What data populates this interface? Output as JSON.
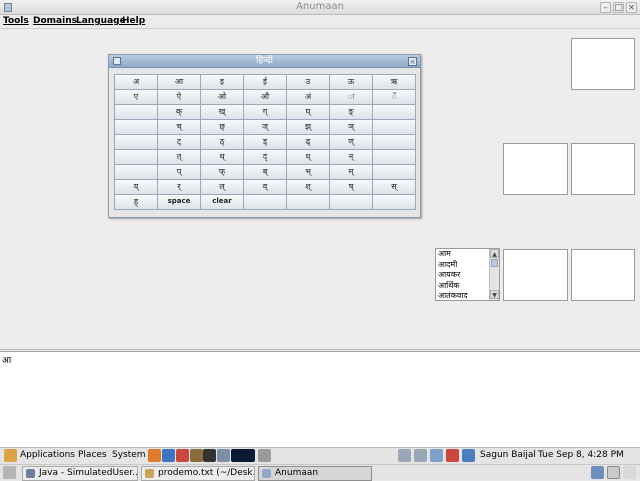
{
  "window": {
    "title": "Anumaan",
    "minimize": "–",
    "maximize": "□",
    "close": "×"
  },
  "menu": [
    "Tools",
    "Domains",
    "Language",
    "Help"
  ],
  "keyboard": {
    "title": "हिन्दी",
    "close": "×",
    "rows": [
      [
        "अ",
        "आ",
        "इ",
        "ई",
        "उ",
        "ऊ",
        "ऋ"
      ],
      [
        "ए",
        "ऐ",
        "ओ",
        "औ",
        "अं",
        "ः",
        "ॅ"
      ],
      [
        "",
        "क्",
        "ख्",
        "ग्",
        "घ्",
        "ङ्",
        ""
      ],
      [
        "",
        "च्",
        "छ्",
        "ज्",
        "झ्",
        "ञ्",
        ""
      ],
      [
        "",
        "ट्",
        "ठ्",
        "ड्",
        "ढ्",
        "ण्",
        ""
      ],
      [
        "",
        "त्",
        "थ्",
        "द्",
        "ध्",
        "न्",
        ""
      ],
      [
        "",
        "प्",
        "फ्",
        "ब्",
        "भ्",
        "म्",
        ""
      ],
      [
        "य्",
        "र्",
        "ल्",
        "व्",
        "श्",
        "ष्",
        "स्"
      ],
      [
        "ह्",
        "space",
        "clear",
        "",
        "",
        "",
        ""
      ]
    ]
  },
  "suggestions": {
    "items": [
      "आम",
      "आदमी",
      "आयकर",
      "आर्थिक",
      "आतंकवाद"
    ],
    "scroll_up": "▲",
    "scroll_down": "▼"
  },
  "text_area": {
    "content": "आ"
  },
  "panel": {
    "applications": "Applications",
    "places": "Places",
    "system": "System",
    "user": "Sagun Baijal",
    "datetime": "Tue Sep  8,  4:28 PM"
  },
  "tasks": [
    {
      "label": "Java - SimulatedUser..."
    },
    {
      "label": "prodemo.txt (~/Desk..."
    },
    {
      "label": "Anumaan"
    }
  ],
  "colors": {
    "accent": "#8ea9c9",
    "background": "#ededed"
  }
}
